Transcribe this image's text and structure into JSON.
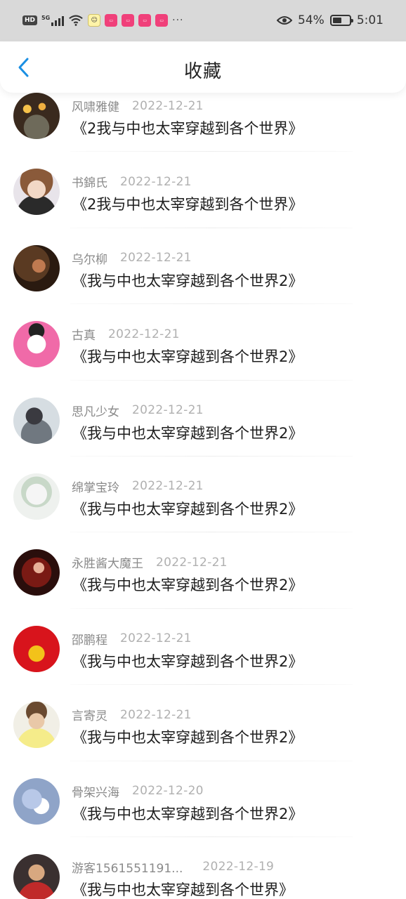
{
  "status_bar": {
    "hd_badge": "HD",
    "network": "5G",
    "battery_percent": "54%",
    "battery_level": 0.54,
    "time": "5:01",
    "more_indicator": "···",
    "app_icons": [
      "bilibili-icon",
      "bilibili-icon",
      "bilibili-icon",
      "bilibili-icon"
    ]
  },
  "header": {
    "title": "收藏",
    "back_icon": "chevron-left-icon"
  },
  "colors": {
    "accent": "#1a8fe3",
    "username": "#8a8a8a",
    "date": "#b0b0b0",
    "title": "#1e1e1e"
  },
  "favorites": [
    {
      "username": "风啸雅健",
      "date": "2022-12-21",
      "title": "《2我与中也太宰穿越到各个世界》"
    },
    {
      "username": "书錦氏",
      "date": "2022-12-21",
      "title": "《2我与中也太宰穿越到各个世界》"
    },
    {
      "username": "乌尔柳",
      "date": "2022-12-21",
      "title": "《我与中也太宰穿越到各个世界2》"
    },
    {
      "username": "古真",
      "date": "2022-12-21",
      "title": "《我与中也太宰穿越到各个世界2》"
    },
    {
      "username": "思凡少女",
      "date": "2022-12-21",
      "title": "《我与中也太宰穿越到各个世界2》"
    },
    {
      "username": "绵掌宝玲",
      "date": "2022-12-21",
      "title": "《我与中也太宰穿越到各个世界2》"
    },
    {
      "username": "永胜酱大魔王",
      "date": "2022-12-21",
      "title": "《我与中也太宰穿越到各个世界2》"
    },
    {
      "username": "邵鹏程",
      "date": "2022-12-21",
      "title": "《我与中也太宰穿越到各个世界2》"
    },
    {
      "username": "言寄灵",
      "date": "2022-12-21",
      "title": "《我与中也太宰穿越到各个世界2》"
    },
    {
      "username": "骨架兴海",
      "date": "2022-12-20",
      "title": "《我与中也太宰穿越到各个世界2》"
    },
    {
      "username": "游客1561551191...",
      "date": "2022-12-19",
      "title": "《我与中也太宰穿越到各个世界》"
    }
  ]
}
